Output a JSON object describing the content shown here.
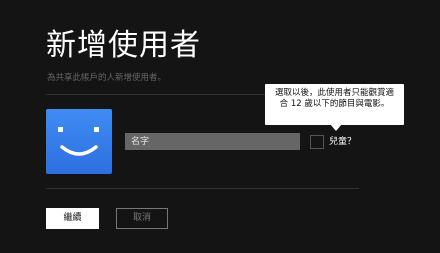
{
  "page": {
    "title": "新增使用者",
    "subtitle": "為共享此帳戶的人新增使用者。"
  },
  "avatar": {
    "icon": "smiley-face-icon",
    "color": "#3f8cf3"
  },
  "form": {
    "name_placeholder": "名字",
    "kids_label": "兒童？",
    "kids_checked": false
  },
  "tooltip": {
    "text": "選取以後，此使用者只能觀賞適合 12 歲以下的節目與電影。"
  },
  "actions": {
    "continue_label": "繼續",
    "cancel_label": "取消"
  },
  "colors": {
    "background": "#141414",
    "primary_button": "#ffffff",
    "input_bg": "#666666"
  }
}
